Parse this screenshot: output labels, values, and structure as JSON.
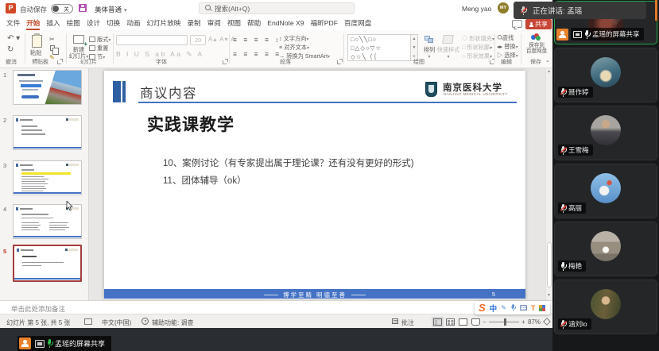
{
  "titlebar": {
    "autosave_label": "自动保存",
    "autosave_state": "关",
    "doc_title": "美体普通",
    "search_placeholder": "搜索(Alt+Q)",
    "user_name": "Meng yao",
    "user_initials": "MY",
    "minimize": "—",
    "ppt_letter": "P"
  },
  "ribbon": {
    "tabs": [
      "文件",
      "开始",
      "插入",
      "绘图",
      "设计",
      "切换",
      "动画",
      "幻灯片放映",
      "录制",
      "审阅",
      "视图",
      "帮助",
      "EndNote X9",
      "福昕PDF",
      "百度网盘"
    ],
    "share_button": "共享",
    "group_labels": {
      "undo": "撤消",
      "clipboard": "剪贴板",
      "slides": "幻灯片",
      "font": "字体",
      "paragraph": "段落",
      "drawing": "绘图",
      "editing": "编辑",
      "save": "保存"
    },
    "clipboard": {
      "paste": "粘贴"
    },
    "slides": {
      "new_slide": "新建幻灯片",
      "layout": "版式",
      "reset": "重置",
      "section": "节"
    },
    "font": {
      "size": "20"
    },
    "paragraph": {
      "text_direction": "文字方向",
      "align_text": "对齐文本",
      "smartart": "转换为 SmartArt"
    },
    "drawing": {
      "arrange": "排列",
      "quick_styles": "快速样式",
      "shape_fill": "形状填充",
      "shape_outline": "形状轮廓",
      "shape_effects": "形状效果"
    },
    "editing": {
      "find": "查找",
      "replace": "替换",
      "select": "选择"
    },
    "save": {
      "baidu": "保存到百度网盘"
    }
  },
  "slide": {
    "header": "商议内容",
    "logo_cn": "南京医科大学",
    "logo_en": "NANJING MEDICAL UNIVERSITY",
    "title": "实践课教学",
    "bullets": [
      "10、案例讨论（有专家提出属于理论课？还有没有更好的形式)",
      "11、团体辅导（ok）"
    ],
    "footer_motto": "博学至精 明德至善",
    "slide_number": "5"
  },
  "thumbnails": [
    {
      "num": "1"
    },
    {
      "num": "2"
    },
    {
      "num": "3"
    },
    {
      "num": "4"
    },
    {
      "num": "5"
    }
  ],
  "notes_placeholder": "单击此处添加备注",
  "statusbar": {
    "slide_position": "幻灯片 第 5 张, 共 5 张",
    "language": "中文(中国)",
    "accessibility": "辅助功能: 调查",
    "comments": "批注",
    "zoom_level": "87%"
  },
  "sogou": {
    "mode": "中",
    "logo": "S"
  },
  "meeting": {
    "speaking_toast": "正在讲话: 孟瑶",
    "share_pill": "孟瑶的屏幕共享",
    "participants": [
      {
        "name": "孟瑶的屏幕共享",
        "mic": "on",
        "sharing": true
      },
      {
        "name": "聂作婷",
        "mic": "muted"
      },
      {
        "name": "王雪梅",
        "mic": "muted"
      },
      {
        "name": "高丽",
        "mic": "muted"
      },
      {
        "name": "梅艳",
        "mic": "on"
      },
      {
        "name": "涵刘lo",
        "mic": "muted"
      }
    ]
  },
  "colors": {
    "ppt_accent": "#c24a2c",
    "slide_blue": "#4472c4",
    "share_red": "#c74634",
    "meeting_green": "#27a448",
    "mic_muted_red": "#e03b2f",
    "selected_thumb": "#a33e3c",
    "orange_badge": "#e8822c"
  }
}
